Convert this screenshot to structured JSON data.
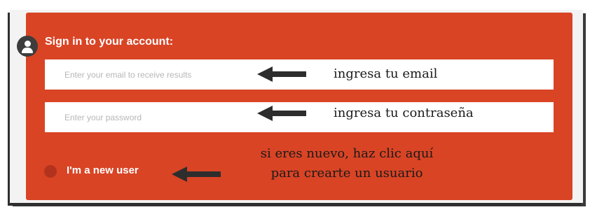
{
  "form": {
    "title": "Sign in to your account:",
    "email_placeholder": "Enter your email to receive results",
    "password_placeholder": "Enter your password",
    "new_user_label": "I'm a new user"
  },
  "annotations": {
    "email_hint": "ingresa tu email",
    "password_hint": "ingresa tu contraseña",
    "new_user_hint_line1": "si eres nuevo, haz clic aquí",
    "new_user_hint_line2": "para crearte un usuario"
  },
  "colors": {
    "card_background": "#d94425",
    "avatar_background": "#3d3d3d",
    "arrow": "#2d2d2d"
  },
  "icons": {
    "avatar": "user-icon",
    "arrow": "arrow-left-icon"
  }
}
